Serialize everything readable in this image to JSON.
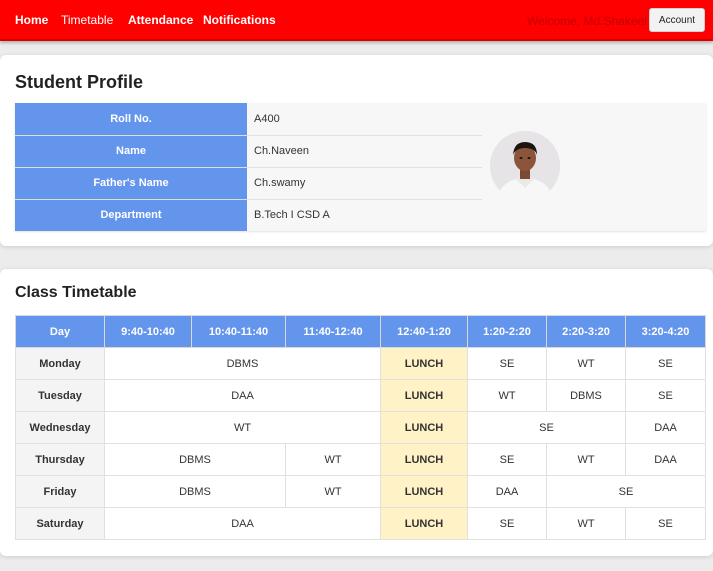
{
  "nav": {
    "items": [
      "Home",
      "Timetable",
      "Attendance",
      "Notifications"
    ],
    "welcome": "Welcome, Md.Shakeel",
    "account_label": "Account"
  },
  "profile": {
    "title": "Student Profile",
    "rows": [
      {
        "label": "Roll No.",
        "value": "A400"
      },
      {
        "label": "Name",
        "value": "Ch.Naveen"
      },
      {
        "label": "Father's Name",
        "value": "Ch.swamy"
      },
      {
        "label": "Department",
        "value": "B.Tech I CSD A"
      }
    ]
  },
  "timetable": {
    "title": "Class Timetable",
    "headers": [
      "Day",
      "9:40-10:40",
      "10:40-11:40",
      "11:40-12:40",
      "12:40-1:20",
      "1:20-2:20",
      "2:20-3:20",
      "3:20-4:20"
    ],
    "lunch_label": "LUNCH",
    "rows": [
      {
        "day": "Monday",
        "cells": [
          "DBMS",
          "SE",
          "WT",
          "SE"
        ]
      },
      {
        "day": "Tuesday",
        "cells": [
          "DAA",
          "WT",
          "DBMS",
          "SE"
        ]
      },
      {
        "day": "Wednesday",
        "cells": [
          "WT",
          "SE",
          "DAA"
        ]
      },
      {
        "day": "Thursday",
        "cells": [
          "DBMS",
          "WT",
          "SE",
          "WT",
          "DAA"
        ]
      },
      {
        "day": "Friday",
        "cells": [
          "DBMS",
          "WT",
          "DAA",
          "SE"
        ]
      },
      {
        "day": "Saturday",
        "cells": [
          "DAA",
          "SE",
          "WT",
          "SE"
        ]
      }
    ]
  },
  "colors": {
    "navbar": "#ff0000",
    "header_blue": "#6495ed",
    "lunch": "#fff2c6"
  }
}
